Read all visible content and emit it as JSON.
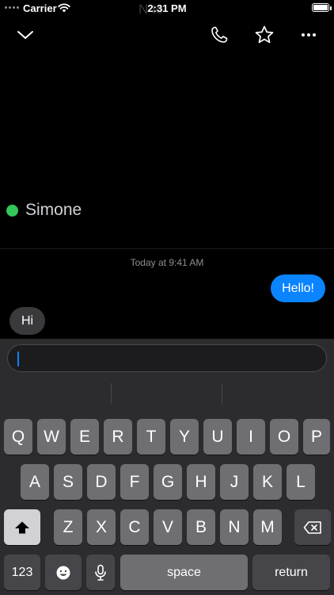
{
  "status_bar": {
    "carrier": "Carrier",
    "time": "2:31 PM",
    "ghost_title": "N        to"
  },
  "nav": {
    "collapse_icon": "chevron-down-icon",
    "call_icon": "phone-icon",
    "favorite_icon": "star-icon",
    "more_icon": "ellipsis-icon"
  },
  "contact": {
    "name": "Simone",
    "status_color": "#34c759"
  },
  "conversation": {
    "timestamp": "Today at 9:41 AM",
    "messages": [
      {
        "direction": "outgoing",
        "text": "Hello!"
      },
      {
        "direction": "incoming",
        "text": "Hi"
      }
    ]
  },
  "composer": {
    "value": ""
  },
  "keyboard": {
    "row1": [
      "Q",
      "W",
      "E",
      "R",
      "T",
      "Y",
      "U",
      "I",
      "O",
      "P"
    ],
    "row2": [
      "A",
      "S",
      "D",
      "F",
      "G",
      "H",
      "J",
      "K",
      "L"
    ],
    "row3": [
      "Z",
      "X",
      "C",
      "V",
      "B",
      "N",
      "M"
    ],
    "numbers_label": "123",
    "space_label": "space",
    "return_label": "return"
  },
  "colors": {
    "accent": "#0a84ff",
    "incoming_bubble": "#3a3a3c",
    "background": "#000000"
  }
}
